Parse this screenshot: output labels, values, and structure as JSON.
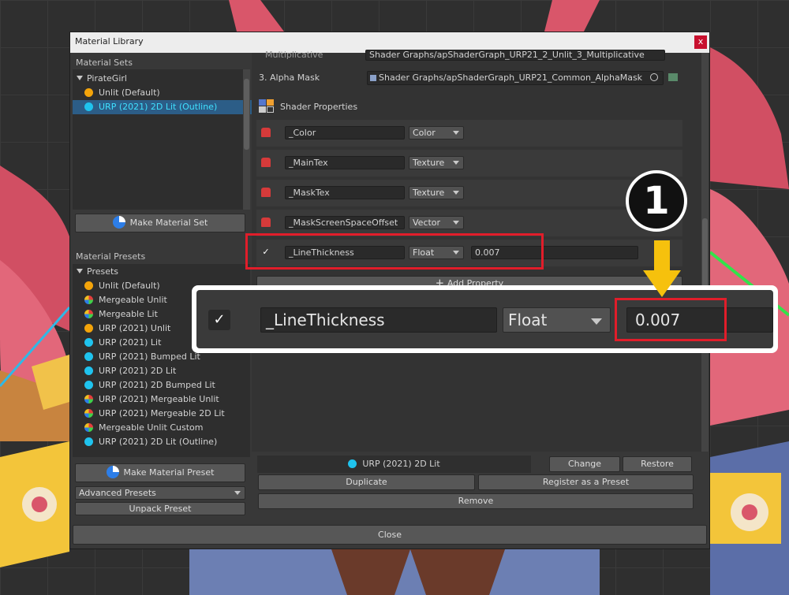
{
  "window": {
    "title": "Material Library",
    "close_glyph": "x"
  },
  "material_sets": {
    "header": "Material Sets",
    "root": "PirateGirl",
    "items": [
      {
        "label": "Unlit (Default)",
        "icon": "orange-circle-icon",
        "selected": false
      },
      {
        "label": "URP (2021) 2D Lit (Outline)",
        "icon": "cyan-circle-icon",
        "selected": true
      }
    ],
    "make_button": "Make Material Set"
  },
  "material_presets": {
    "header": "Material Presets",
    "root": "Presets",
    "items": [
      {
        "label": "Unlit (Default)",
        "icon": "orange-circle-icon"
      },
      {
        "label": "Mergeable Unlit",
        "icon": "multicolor-circle-icon"
      },
      {
        "label": "Mergeable Lit",
        "icon": "multicolor-circle-icon"
      },
      {
        "label": "URP (2021) Unlit",
        "icon": "orange-circle-icon"
      },
      {
        "label": "URP (2021) Lit",
        "icon": "cyan-circle-icon"
      },
      {
        "label": "URP (2021) Bumped Lit",
        "icon": "cyan-circle-icon"
      },
      {
        "label": "URP (2021) 2D Lit",
        "icon": "cyan-circle-icon"
      },
      {
        "label": "URP (2021) 2D Bumped Lit",
        "icon": "cyan-circle-icon"
      },
      {
        "label": "URP (2021) Mergeable Unlit",
        "icon": "multicolor-circle-icon"
      },
      {
        "label": "URP (2021) Mergeable 2D Lit",
        "icon": "multicolor-circle-icon"
      },
      {
        "label": "Mergeable Unlit Custom",
        "icon": "multicolor-circle-icon"
      },
      {
        "label": "URP (2021) 2D Lit (Outline)",
        "icon": "cyan-circle-icon"
      }
    ],
    "make_button": "Make Material Preset",
    "advanced": "Advanced Presets",
    "unpack": "Unpack Preset"
  },
  "shaders": {
    "multiplicative_label": "Multiplicative",
    "multiplicative_path": "Shader Graphs/apShaderGraph_URP21_2_Unlit_3_Multiplicative",
    "alpha_label": "3. Alpha Mask",
    "alpha_path": "Shader Graphs/apShaderGraph_URP21_Common_AlphaMask"
  },
  "shader_properties": {
    "header": "Shader Properties",
    "rows": [
      {
        "name": "_Color",
        "type": "Color",
        "locked": true
      },
      {
        "name": "_MainTex",
        "type": "Texture",
        "locked": true
      },
      {
        "name": "_MaskTex",
        "type": "Texture",
        "locked": true
      },
      {
        "name": "_MaskScreenSpaceOffset",
        "type": "Vector",
        "locked": true
      },
      {
        "name": "_LineThickness",
        "type": "Float",
        "value": "0.007",
        "locked": false,
        "checked": true
      }
    ],
    "add_property": "Add Property"
  },
  "zoom_callout": {
    "name": "_LineThickness",
    "type": "Float",
    "value": "0.007"
  },
  "step_badge": "1",
  "bottom": {
    "current": "URP (2021) 2D Lit",
    "change": "Change",
    "restore": "Restore",
    "duplicate": "Duplicate",
    "register": "Register as a Preset",
    "remove": "Remove",
    "close": "Close"
  },
  "colors": {
    "highlight": "#e11d2a",
    "arrow": "#f6c10d",
    "selection": "#2c5d87"
  }
}
